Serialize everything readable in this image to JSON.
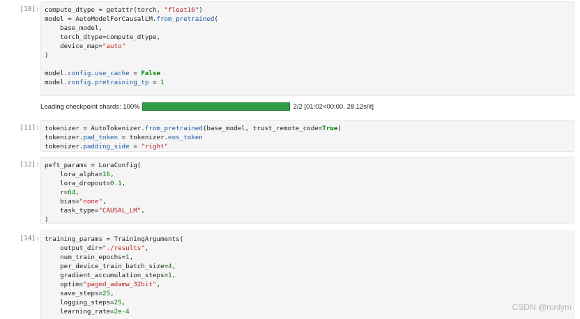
{
  "cells": {
    "c10": {
      "prompt": "[10]:",
      "lines": [
        [
          [
            "compute_dtype = getattr(torch, ",
            ""
          ],
          [
            "\"float16\"",
            "str"
          ],
          [
            ")",
            ""
          ]
        ],
        [
          [
            "model = AutoModelForCausalLM.",
            ""
          ],
          [
            "from_pretrained",
            "attr"
          ],
          [
            "(",
            ""
          ]
        ],
        [
          [
            "    base_model,",
            ""
          ]
        ],
        [
          [
            "    torch_dtype=compute_dtype,",
            ""
          ]
        ],
        [
          [
            "    device_map=",
            ""
          ],
          [
            "\"auto\"",
            "str"
          ]
        ],
        [
          [
            ")",
            ""
          ]
        ],
        [
          [
            "",
            ""
          ]
        ],
        [
          [
            "model.",
            ""
          ],
          [
            "config",
            "attr"
          ],
          [
            ".",
            ""
          ],
          [
            "use_cache",
            "attr"
          ],
          [
            " = ",
            ""
          ],
          [
            "False",
            "kw"
          ]
        ],
        [
          [
            "model.",
            ""
          ],
          [
            "config",
            "attr"
          ],
          [
            ".",
            ""
          ],
          [
            "pretraining_tp",
            "attr"
          ],
          [
            " = ",
            ""
          ],
          [
            "1",
            "num"
          ]
        ]
      ]
    },
    "output": {
      "label": "Loading checkpoint shards: 100%",
      "progress": 1.0,
      "stats": "2/2 [01:02<00:00, 28.12s/it]"
    },
    "c11": {
      "prompt": "[11]:",
      "lines": [
        [
          [
            "tokenizer = AutoTokenizer.",
            ""
          ],
          [
            "from_pretrained",
            "attr"
          ],
          [
            "(base_model, trust_remote_code=",
            ""
          ],
          [
            "True",
            "kw"
          ],
          [
            ")",
            ""
          ]
        ],
        [
          [
            "tokenizer.",
            ""
          ],
          [
            "pad_token",
            "attr"
          ],
          [
            " = tokenizer.",
            ""
          ],
          [
            "eos_token",
            "attr"
          ]
        ],
        [
          [
            "tokenizer.",
            ""
          ],
          [
            "padding_side",
            "attr"
          ],
          [
            " = ",
            ""
          ],
          [
            "\"right\"",
            "str"
          ]
        ]
      ]
    },
    "c12": {
      "prompt": "[12]:",
      "lines": [
        [
          [
            "peft_params = LoraConfig(",
            ""
          ]
        ],
        [
          [
            "    lora_alpha=",
            ""
          ],
          [
            "16",
            "num"
          ],
          [
            ",",
            ""
          ]
        ],
        [
          [
            "    lora_dropout=",
            ""
          ],
          [
            "0.1",
            "num"
          ],
          [
            ",",
            ""
          ]
        ],
        [
          [
            "    r=",
            ""
          ],
          [
            "64",
            "num"
          ],
          [
            ",",
            ""
          ]
        ],
        [
          [
            "    bias=",
            ""
          ],
          [
            "\"none\"",
            "str"
          ],
          [
            ",",
            ""
          ]
        ],
        [
          [
            "    task_type=",
            ""
          ],
          [
            "\"CAUSAL_LM\"",
            "str"
          ],
          [
            ",",
            ""
          ]
        ],
        [
          [
            ")",
            ""
          ]
        ]
      ]
    },
    "c14": {
      "prompt": "[14]:",
      "lines": [
        [
          [
            "training_params = TrainingArguments(",
            ""
          ]
        ],
        [
          [
            "    output_dir=",
            ""
          ],
          [
            "\"./results\"",
            "str"
          ],
          [
            ",",
            ""
          ]
        ],
        [
          [
            "    num_train_epochs=",
            ""
          ],
          [
            "1",
            "num"
          ],
          [
            ",",
            ""
          ]
        ],
        [
          [
            "    per_device_train_batch_size=",
            ""
          ],
          [
            "4",
            "num"
          ],
          [
            ",",
            ""
          ]
        ],
        [
          [
            "    gradient_accumulation_steps=",
            ""
          ],
          [
            "1",
            "num"
          ],
          [
            ",",
            ""
          ]
        ],
        [
          [
            "    optim=",
            ""
          ],
          [
            "\"paged_adamw_32bit\"",
            "str"
          ],
          [
            ",",
            ""
          ]
        ],
        [
          [
            "    save_steps=",
            ""
          ],
          [
            "25",
            "num"
          ],
          [
            ",",
            ""
          ]
        ],
        [
          [
            "    logging_steps=",
            ""
          ],
          [
            "25",
            "num"
          ],
          [
            ",",
            ""
          ]
        ],
        [
          [
            "    learning_rate=",
            ""
          ],
          [
            "2e-4",
            "num"
          ]
        ]
      ]
    }
  },
  "watermark": "CSDN @ronlym"
}
